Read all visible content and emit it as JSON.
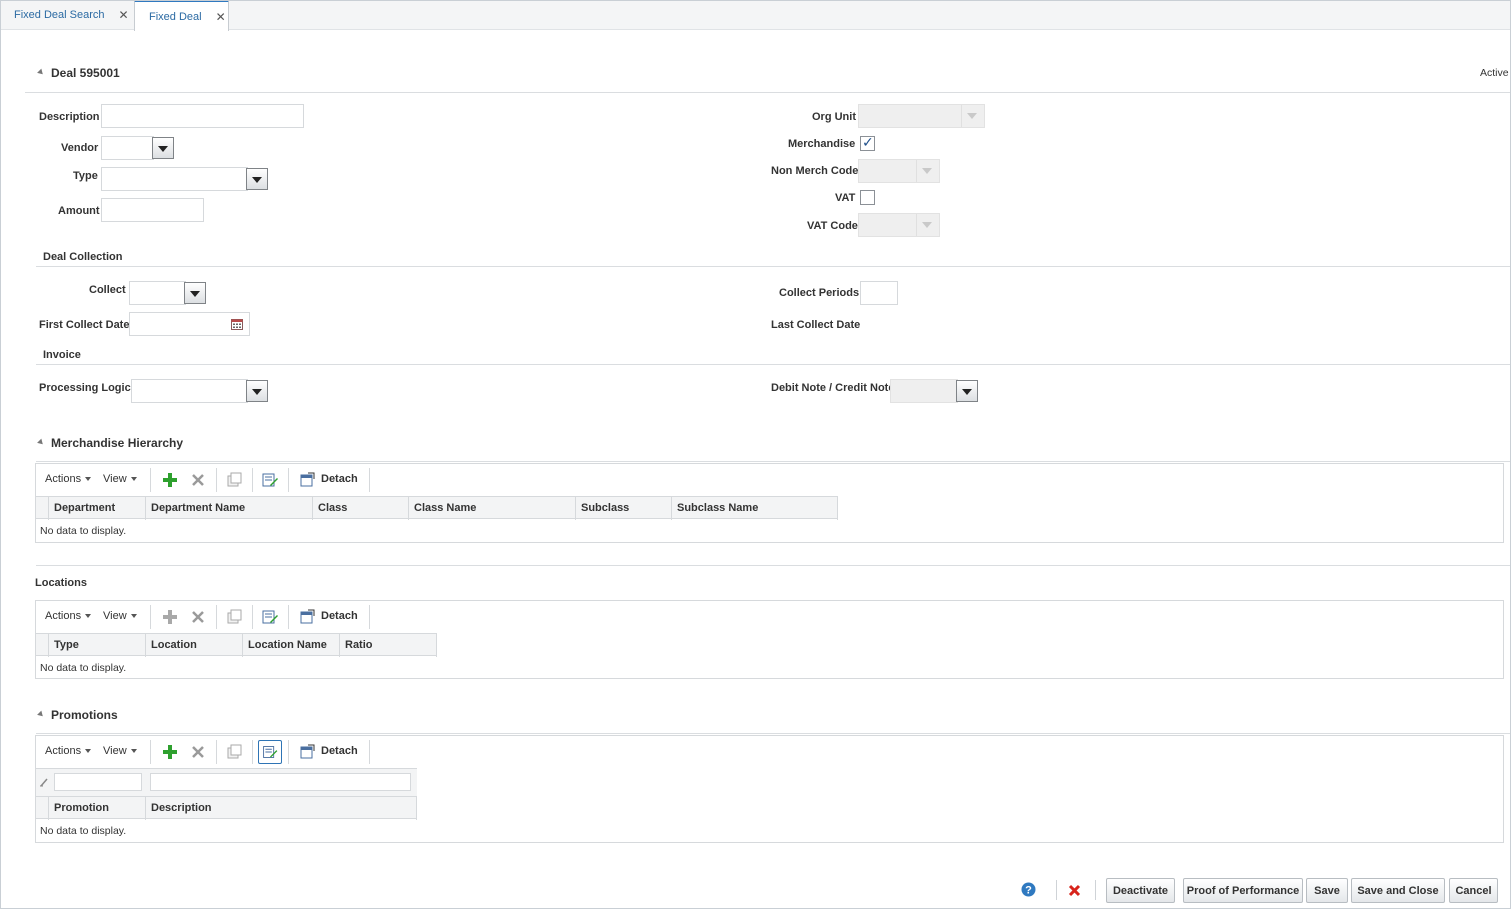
{
  "tabs": [
    {
      "label": "Fixed Deal Search",
      "close": "✕"
    },
    {
      "label": "Fixed Deal",
      "close": "✕"
    }
  ],
  "deal": {
    "title": "Deal 595001",
    "status": "Active"
  },
  "form_left": {
    "description_label": "Description",
    "vendor_label": "Vendor",
    "type_label": "Type",
    "amount_label": "Amount"
  },
  "form_right": {
    "org_unit_label": "Org Unit",
    "merchandise_label": "Merchandise",
    "merchandise_checked": true,
    "non_merch_code_label": "Non Merch Code",
    "vat_label": "VAT",
    "vat_checked": false,
    "vat_code_label": "VAT Code"
  },
  "deal_collection": {
    "title": "Deal Collection",
    "collect_label": "Collect",
    "first_collect_date_label": "First Collect Date",
    "collect_periods_label": "Collect Periods",
    "last_collect_date_label": "Last Collect Date"
  },
  "invoice": {
    "title": "Invoice",
    "processing_logic_label": "Processing Logic",
    "debit_credit_label": "Debit Note / Credit Note"
  },
  "toolbar": {
    "actions": "Actions",
    "view": "View",
    "detach": "Detach"
  },
  "merch_hierarchy": {
    "title": "Merchandise Hierarchy",
    "columns": [
      "Department",
      "Department Name",
      "Class",
      "Class Name",
      "Subclass",
      "Subclass Name"
    ],
    "empty": "No data to display."
  },
  "locations": {
    "title": "Locations",
    "columns": [
      "Type",
      "Location",
      "Location Name",
      "Ratio"
    ],
    "empty": "No data to display."
  },
  "promotions": {
    "title": "Promotions",
    "columns": [
      "Promotion",
      "Description"
    ],
    "empty": "No data to display."
  },
  "footer": {
    "deactivate": "Deactivate",
    "proof_of_performance": "Proof of Performance",
    "save": "Save",
    "save_and_close": "Save and Close",
    "cancel": "Cancel"
  },
  "colors": {
    "accent": "#2f79c0",
    "tab_text": "#2b6aa3",
    "add_green": "#2ea02e",
    "delete_red": "#d8241c"
  }
}
